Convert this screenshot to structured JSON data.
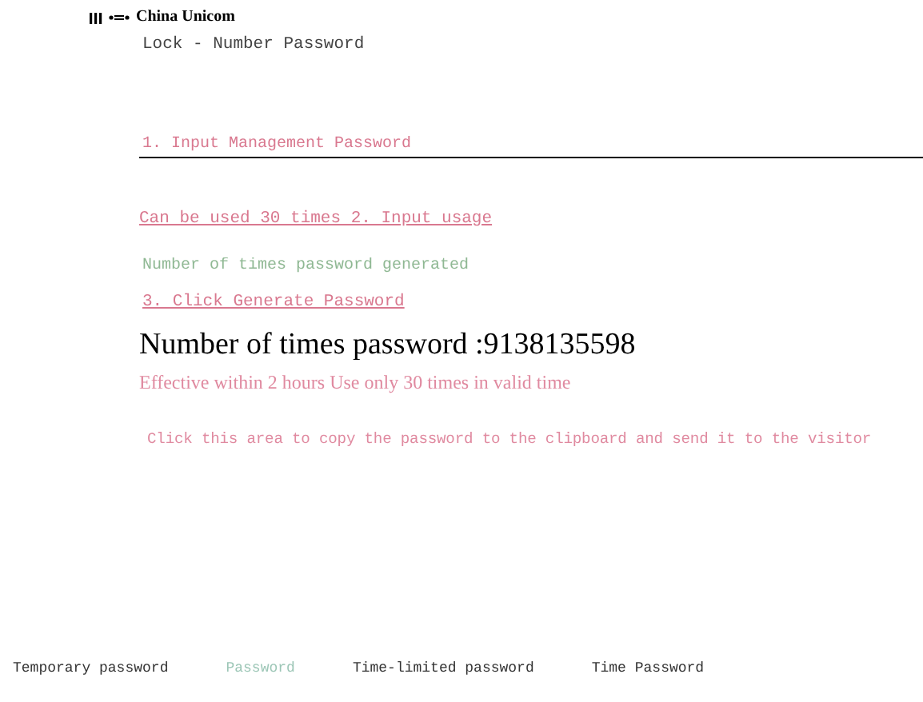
{
  "status_bar": {
    "carrier": "China Unicom"
  },
  "title": "Lock - Number Password",
  "management_password": {
    "placeholder": "1. Input Management Password"
  },
  "usage_label": "Can be used 30 times 2. Input usage",
  "usage_field": {
    "placeholder": "Number of times password generated"
  },
  "generate_button": "3. Click Generate Password",
  "password_line": "Number of times password :9138135598",
  "validity_note": "Effective within 2 hours Use only 30 times in valid time",
  "copy_area": "Click this area to copy the password to the clipboard and send it to the visitor",
  "tabs": [
    {
      "label": "Temporary password",
      "selected": false
    },
    {
      "label": "Password",
      "selected": true
    },
    {
      "label": "Time-limited password",
      "selected": false
    },
    {
      "label": "Time Password",
      "selected": false
    }
  ]
}
